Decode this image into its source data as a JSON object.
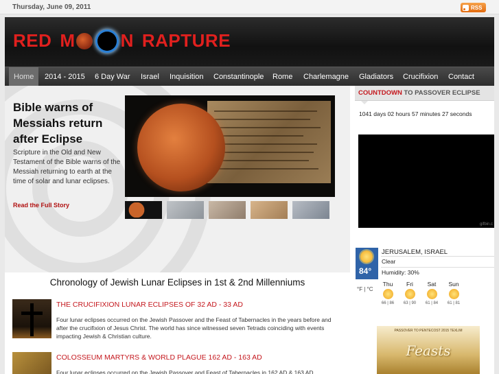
{
  "topbar": {
    "date": "Thursday, June 09, 2011",
    "rss_label": "RSS"
  },
  "header": {
    "logo_part1": "RED",
    "logo_part2": "M",
    "logo_part3": "N",
    "logo_part4": "RAPTURE"
  },
  "nav": {
    "items": [
      "Home",
      "2014 - 2015",
      "6 Day War",
      "Israel",
      "Inquisition",
      "Constantinople",
      "Rome",
      "Charlemagne",
      "Gladiators",
      "Crucifixion",
      "Contact"
    ]
  },
  "feature": {
    "title": "Bible warns of Messiahs return after Eclipse",
    "description": "Scripture in the Old and New Testament of the Bible warns of the Messiah returning to earth at the time of solar and lunar eclipses.",
    "read_more": "Read the Full Story"
  },
  "chronology": {
    "heading": "Chronology of Jewish Lunar Eclipses in 1st & 2nd Millenniums",
    "articles": [
      {
        "title": "THE CRUCIFIXION LUNAR ECLIPSES OF 32 AD - 33 AD",
        "text": "Four lunar eclipses occurred on the Jewish Passover and the Feast of Tabernacles in the years before and after the crucifixion of Jesus Christ. The world has since witnessed seven Tetrads coinciding with events impacting Jewish & Christian culture."
      },
      {
        "title": "COLOSSEUM MARTYRS & WORLD PLAGUE 162 AD - 163 AD",
        "text": "Four lunar eclipses occurred on the Jewish Passover and Feast of Tabernacles in 162 AD & 163 AD"
      }
    ]
  },
  "countdown": {
    "heading_red": "COUNTDOWN",
    "heading_rest": " TO PASSOVER ECLIPSE",
    "text": "1041 days 02 hours 57 minutes 27 seconds"
  },
  "video": {
    "watermark": "gifbin.c"
  },
  "weather": {
    "temp": "84°",
    "city": "JERUSALEM, ISRAEL",
    "condition": "Clear",
    "humidity": "Humidity: 30%",
    "units": "°F | °C",
    "forecast": [
      {
        "day": "Thu",
        "temps": "66 | 86"
      },
      {
        "day": "Fri",
        "temps": "63 | 90"
      },
      {
        "day": "Sat",
        "temps": "61 | 84"
      },
      {
        "day": "Sun",
        "temps": "61 | 81"
      }
    ]
  },
  "poster": {
    "top_text": "PASSOVER TO PENTECOST 2015 TEXLIM",
    "title": "Feasts"
  }
}
